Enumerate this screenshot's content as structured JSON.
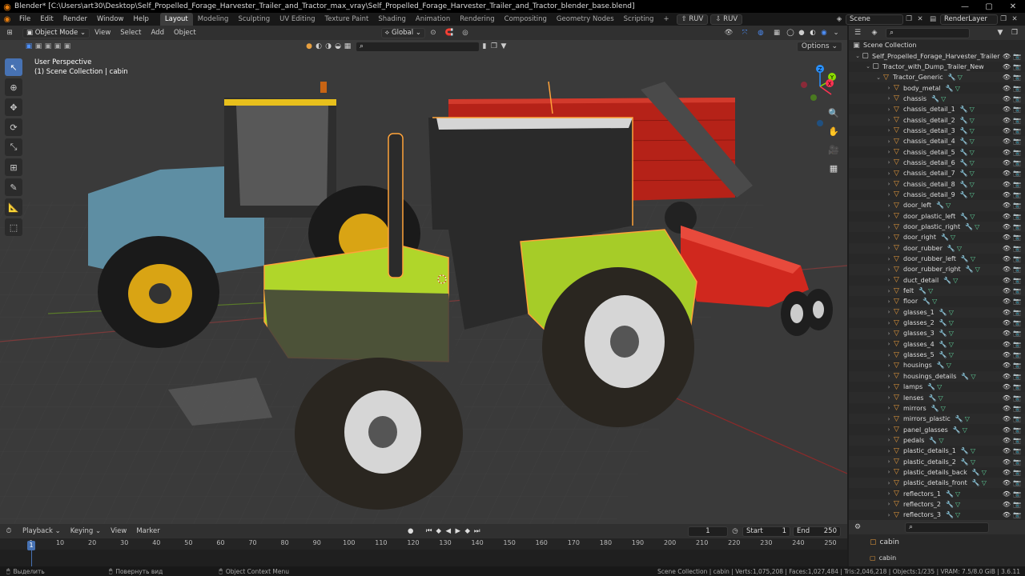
{
  "titlebar": {
    "app_icon": "blender-logo-icon",
    "title": "Blender* [C:\\Users\\art30\\Desktop\\Self_Propelled_Forage_Harvester_Trailer_and_Tractor_max_vray\\Self_Propelled_Forage_Harvester_Trailer_and_Tractor_blender_base.blend]",
    "minimize": "—",
    "maximize": "▢",
    "close": "✕"
  },
  "menu": [
    "File",
    "Edit",
    "Render",
    "Window",
    "Help"
  ],
  "workspaces": [
    {
      "label": "Layout",
      "active": true
    },
    {
      "label": "Modeling"
    },
    {
      "label": "Sculpting"
    },
    {
      "label": "UV Editing"
    },
    {
      "label": "Texture Paint"
    },
    {
      "label": "Shading"
    },
    {
      "label": "Animation"
    },
    {
      "label": "Rendering"
    },
    {
      "label": "Compositing"
    },
    {
      "label": "Geometry Nodes"
    },
    {
      "label": "Scripting"
    }
  ],
  "ws_add": "+",
  "ruv1": "RUV",
  "ruv2": "RUV",
  "scene_field": "Scene",
  "renderlayer_field": "RenderLayer",
  "viewport": {
    "mode": "Object Mode",
    "view": "View",
    "select": "Select",
    "add": "Add",
    "object": "Object",
    "orientation": "Global",
    "options": "Options",
    "info_line1": "User Perspective",
    "info_line2": "(1) Scene Collection | cabin",
    "gizmo": {
      "x": "X",
      "y": "Y",
      "z": "Z"
    }
  },
  "outliner": {
    "root": "Scene Collection",
    "items": [
      {
        "label": "Self_Propelled_Forage_Harvester_Trailer",
        "depth": 1,
        "open": true,
        "type": "collection"
      },
      {
        "label": "Tractor_with_Dump_Trailer_New",
        "depth": 2,
        "open": true,
        "type": "collection"
      },
      {
        "label": "Tractor_Generic",
        "depth": 3,
        "open": true,
        "type": "object"
      },
      {
        "label": "body_metal",
        "depth": 4
      },
      {
        "label": "chassis",
        "depth": 4
      },
      {
        "label": "chassis_detail_1",
        "depth": 4
      },
      {
        "label": "chassis_detail_2",
        "depth": 4
      },
      {
        "label": "chassis_detail_3",
        "depth": 4
      },
      {
        "label": "chassis_detail_4",
        "depth": 4
      },
      {
        "label": "chassis_detail_5",
        "depth": 4
      },
      {
        "label": "chassis_detail_6",
        "depth": 4
      },
      {
        "label": "chassis_detail_7",
        "depth": 4
      },
      {
        "label": "chassis_detail_8",
        "depth": 4
      },
      {
        "label": "chassis_detail_9",
        "depth": 4
      },
      {
        "label": "door_left",
        "depth": 4
      },
      {
        "label": "door_plastic_left",
        "depth": 4
      },
      {
        "label": "door_plastic_right",
        "depth": 4
      },
      {
        "label": "door_right",
        "depth": 4
      },
      {
        "label": "door_rubber",
        "depth": 4
      },
      {
        "label": "door_rubber_left",
        "depth": 4
      },
      {
        "label": "door_rubber_right",
        "depth": 4
      },
      {
        "label": "duct_detail",
        "depth": 4
      },
      {
        "label": "felt",
        "depth": 4
      },
      {
        "label": "floor",
        "depth": 4
      },
      {
        "label": "glasses_1",
        "depth": 4
      },
      {
        "label": "glasses_2",
        "depth": 4
      },
      {
        "label": "glasses_3",
        "depth": 4
      },
      {
        "label": "glasses_4",
        "depth": 4
      },
      {
        "label": "glasses_5",
        "depth": 4
      },
      {
        "label": "housings",
        "depth": 4
      },
      {
        "label": "housings_details",
        "depth": 4
      },
      {
        "label": "lamps",
        "depth": 4
      },
      {
        "label": "lenses",
        "depth": 4
      },
      {
        "label": "mirrors",
        "depth": 4
      },
      {
        "label": "mirrors_plastic",
        "depth": 4
      },
      {
        "label": "panel_glasses",
        "depth": 4
      },
      {
        "label": "pedals",
        "depth": 4
      },
      {
        "label": "plastic_details_1",
        "depth": 4
      },
      {
        "label": "plastic_details_2",
        "depth": 4
      },
      {
        "label": "plastic_details_back",
        "depth": 4
      },
      {
        "label": "plastic_details_front",
        "depth": 4
      },
      {
        "label": "reflectors_1",
        "depth": 4
      },
      {
        "label": "reflectors_2",
        "depth": 4
      },
      {
        "label": "reflectors_3",
        "depth": 4
      }
    ]
  },
  "properties": {
    "object_name": "cabin",
    "sub_name": "cabin"
  },
  "timeline": {
    "playback": "Playback",
    "keying": "Keying",
    "view": "View",
    "marker": "Marker",
    "current_frame": "1",
    "start_label": "Start",
    "start": "1",
    "end_label": "End",
    "end": "250",
    "ruler": [
      "1",
      "10",
      "20",
      "30",
      "40",
      "50",
      "60",
      "70",
      "80",
      "90",
      "100",
      "110",
      "120",
      "130",
      "140",
      "150",
      "160",
      "170",
      "180",
      "190",
      "200",
      "210",
      "220",
      "230",
      "240",
      "250"
    ]
  },
  "status": {
    "select": "Выделить",
    "rotate": "Повернуть вид",
    "context": "Object Context Menu",
    "stats": "Scene Collection | cabin | Verts:1,075,208 | Faces:1,027,484 | Tris:2,046,218 | Objects:1/235 | VRAM: 7.5/8.0 GiB | 3.6.11"
  },
  "colors": {
    "accent": "#4772b3",
    "selection": "#ffa33a",
    "tractor_green": "#b8e030",
    "trailer_red": "#c8281e",
    "tractor_blue": "#5a8aa0"
  }
}
